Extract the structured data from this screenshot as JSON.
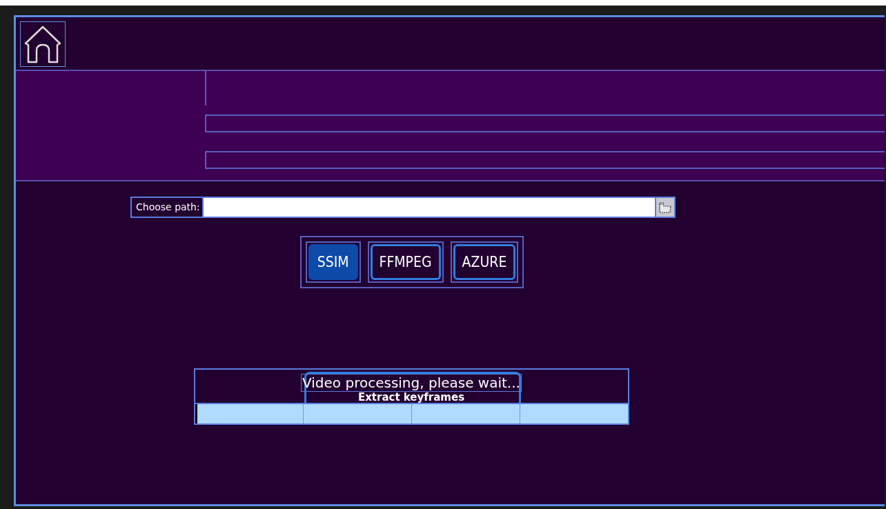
{
  "path_picker": {
    "label": "Choose path:"
  },
  "modes": [
    {
      "label": "SSIM",
      "selected": true
    },
    {
      "label": "FFMPEG",
      "selected": false
    },
    {
      "label": "AZURE",
      "selected": false
    }
  ],
  "progress": {
    "message": "Video processing, please wait...",
    "caption": "Extract keyframes",
    "level": 0.005
  }
}
